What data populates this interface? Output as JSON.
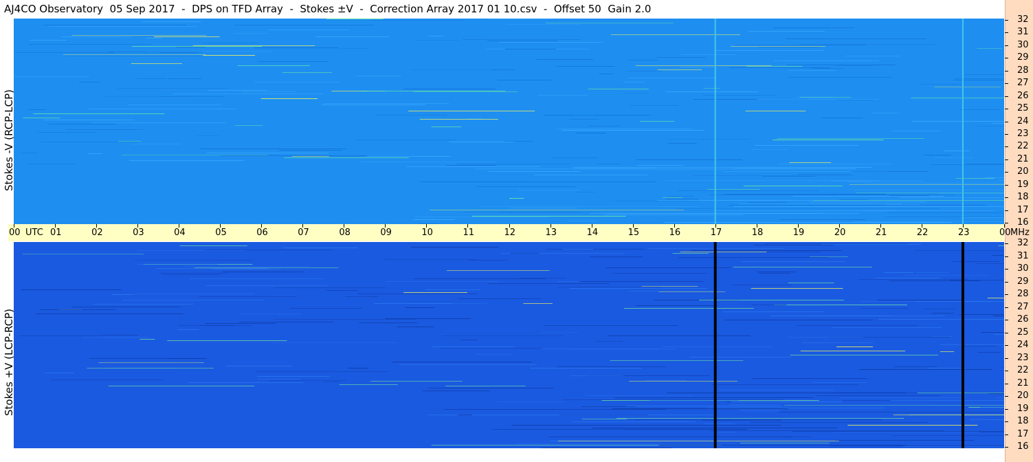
{
  "header": {
    "title": "AJ4CO Observatory  05 Sep 2017  -  DPS on TFD Array  -  Stokes ±V  -  Correction Array 2017 01 10.csv  -  Offset 50  Gain 2.0"
  },
  "panels": {
    "top_label": "Stokes -V (RCP-LCP)",
    "bottom_label": "Stokes +V (LCP-RCP)"
  },
  "axis": {
    "utc_label": "UTC",
    "mhz_label": "MHz"
  },
  "colors": {
    "top_background": "#1e8ff0",
    "bottom_background": "#1a5ae0",
    "axis_bar": "#ffffc4",
    "right_column": "#ffdcc0"
  },
  "chart_data": {
    "type": "heatmap",
    "title": "AJ4CO Observatory  05 Sep 2017  -  DPS on TFD Array  -  Stokes ±V  -  Correction Array 2017 01 10.csv  -  Offset 50  Gain 2.0",
    "xlabel": "UTC",
    "ylabel": "MHz",
    "x_ticks": [
      "00",
      "01",
      "02",
      "03",
      "04",
      "05",
      "06",
      "07",
      "08",
      "09",
      "10",
      "11",
      "12",
      "13",
      "14",
      "15",
      "16",
      "17",
      "18",
      "19",
      "20",
      "21",
      "22",
      "23",
      "00"
    ],
    "y_ticks": [
      "32",
      "31",
      "30",
      "29",
      "28",
      "27",
      "26",
      "25",
      "24",
      "23",
      "22",
      "21",
      "20",
      "19",
      "18",
      "17",
      "16"
    ],
    "xlim": [
      0,
      24
    ],
    "ylim": [
      16,
      32
    ],
    "series": [
      {
        "name": "Stokes -V (RCP-LCP)",
        "marker_hours": [
          17,
          23
        ]
      },
      {
        "name": "Stokes +V (LCP-RCP)",
        "marker_hours": [
          17,
          23
        ]
      }
    ]
  }
}
